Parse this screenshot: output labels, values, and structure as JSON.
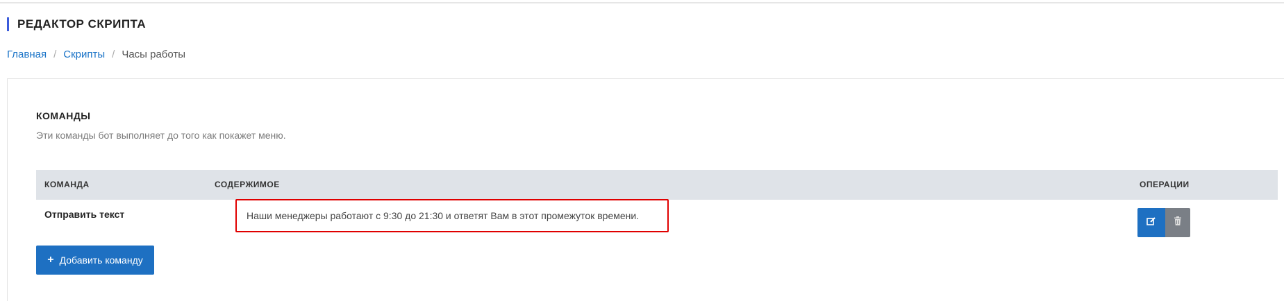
{
  "header": {
    "title": "РЕДАКТОР СКРИПТА"
  },
  "breadcrumb": {
    "items": [
      "Главная",
      "Скрипты",
      "Часы работы"
    ],
    "separator": "/"
  },
  "commands_section": {
    "title": "КОМАНДЫ",
    "description": "Эти команды бот выполняет до того как покажет меню.",
    "table": {
      "columns": [
        "КОМАНДА",
        "СОДЕРЖИМОЕ",
        "ОПЕРАЦИИ"
      ],
      "rows": [
        {
          "command": "Отправить текст",
          "content": "Наши менеджеры работают с 9:30 до 21:30 и ответят Вам в этот промежуток времени.",
          "operations": [
            "edit-icon",
            "trash-icon"
          ]
        }
      ]
    },
    "add_button": {
      "icon": "+",
      "label": "Добавить команду"
    }
  },
  "colors": {
    "accent": "#3b5bdb",
    "primary_button": "#1e70c2",
    "secondary_button": "#7a7f86",
    "highlight_border": "#e00000",
    "table_header_bg": "#dfe3e8",
    "link": "#1a73c7"
  }
}
